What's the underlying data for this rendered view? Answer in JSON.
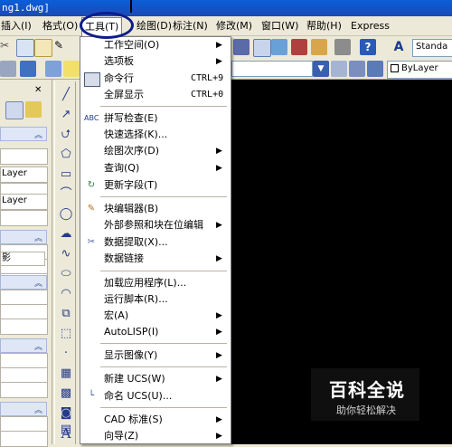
{
  "window": {
    "title": "ng1.dwg]"
  },
  "menubar": {
    "items": [
      {
        "label": "插入(I)"
      },
      {
        "label": "格式(O)"
      },
      {
        "label": "工具(T)"
      },
      {
        "label": "绘图(D)"
      },
      {
        "label": "标注(N)"
      },
      {
        "label": "修改(M)"
      },
      {
        "label": "窗口(W)"
      },
      {
        "label": "帮助(H)"
      },
      {
        "label": "Express"
      }
    ]
  },
  "toolbar": {
    "text_style": "Standa",
    "layer": "ByLayer"
  },
  "leftpanel": {
    "rows": [
      "Layer",
      "Layer",
      "影"
    ]
  },
  "tools_menu": {
    "items": [
      {
        "label": "工作空间(O)",
        "submenu": true
      },
      {
        "label": "选项板",
        "submenu": true
      },
      {
        "label": "命令行",
        "shortcut": "CTRL+9",
        "icon": "command-line-icon"
      },
      {
        "label": "全屏显示",
        "shortcut": "CTRL+0"
      },
      {
        "label": "拼写检查(E)",
        "icon": "spell-check-icon"
      },
      {
        "label": "快速选择(K)..."
      },
      {
        "label": "绘图次序(D)",
        "submenu": true
      },
      {
        "label": "查询(Q)",
        "submenu": true
      },
      {
        "label": "更新字段(T)",
        "icon": "update-field-icon"
      },
      {
        "label": "块编辑器(B)",
        "icon": "block-editor-icon"
      },
      {
        "label": "外部参照和块在位编辑",
        "submenu": true
      },
      {
        "label": "数据提取(X)...",
        "icon": "data-extraction-icon"
      },
      {
        "label": "数据链接",
        "submenu": true
      },
      {
        "label": "加载应用程序(L)..."
      },
      {
        "label": "运行脚本(R)..."
      },
      {
        "label": "宏(A)",
        "submenu": true
      },
      {
        "label": "AutoLISP(I)",
        "submenu": true
      },
      {
        "label": "显示图像(Y)",
        "submenu": true
      },
      {
        "label": "新建 UCS(W)",
        "submenu": true
      },
      {
        "label": "命名 UCS(U)...",
        "icon": "named-ucs-icon"
      },
      {
        "label": "CAD 标准(S)",
        "submenu": true
      },
      {
        "label": "向导(Z)",
        "submenu": true
      }
    ]
  },
  "watermark": {
    "title": "百科全说",
    "subtitle": "助你轻松解决"
  }
}
